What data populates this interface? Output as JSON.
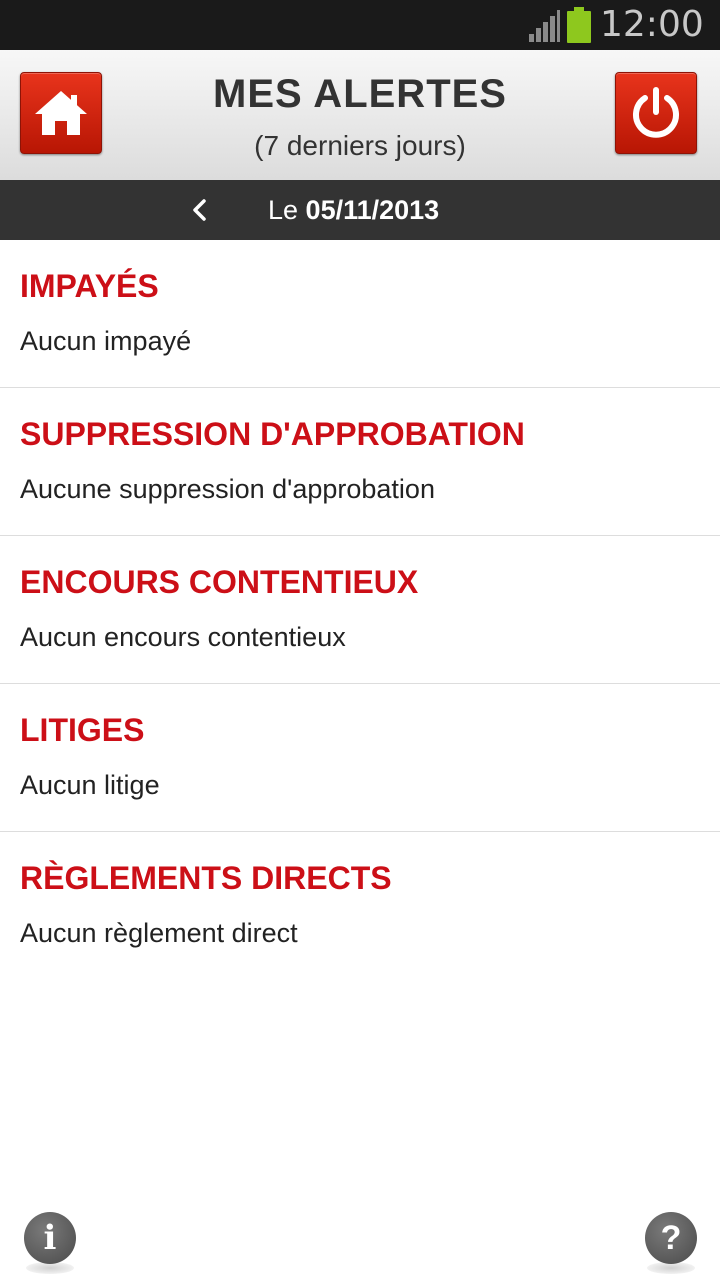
{
  "status_bar": {
    "time": "12:00",
    "signal_icon": "signal-icon",
    "battery_icon": "battery-icon",
    "battery_color": "#8ec81e"
  },
  "header": {
    "title": "MES ALERTES",
    "subtitle": "(7 derniers jours)",
    "home_icon": "home-icon",
    "power_icon": "power-icon",
    "accent_color": "#d3220d"
  },
  "date_bar": {
    "prefix": "Le",
    "date": "05/11/2013",
    "prev_icon": "chevron-left-icon"
  },
  "alerts": [
    {
      "title": "IMPAYÉS",
      "message": "Aucun impayé"
    },
    {
      "title": "SUPPRESSION D'APPROBATION",
      "message": "Aucune suppression d'approbation"
    },
    {
      "title": "ENCOURS CONTENTIEUX",
      "message": "Aucun encours contentieux"
    },
    {
      "title": "LITIGES",
      "message": "Aucun litige"
    },
    {
      "title": "RÈGLEMENTS DIRECTS",
      "message": "Aucun règlement direct"
    }
  ],
  "footer": {
    "info_label": "i",
    "help_label": "?"
  },
  "colors": {
    "alert_title": "#cc0f17",
    "date_bar_bg": "#333333"
  }
}
